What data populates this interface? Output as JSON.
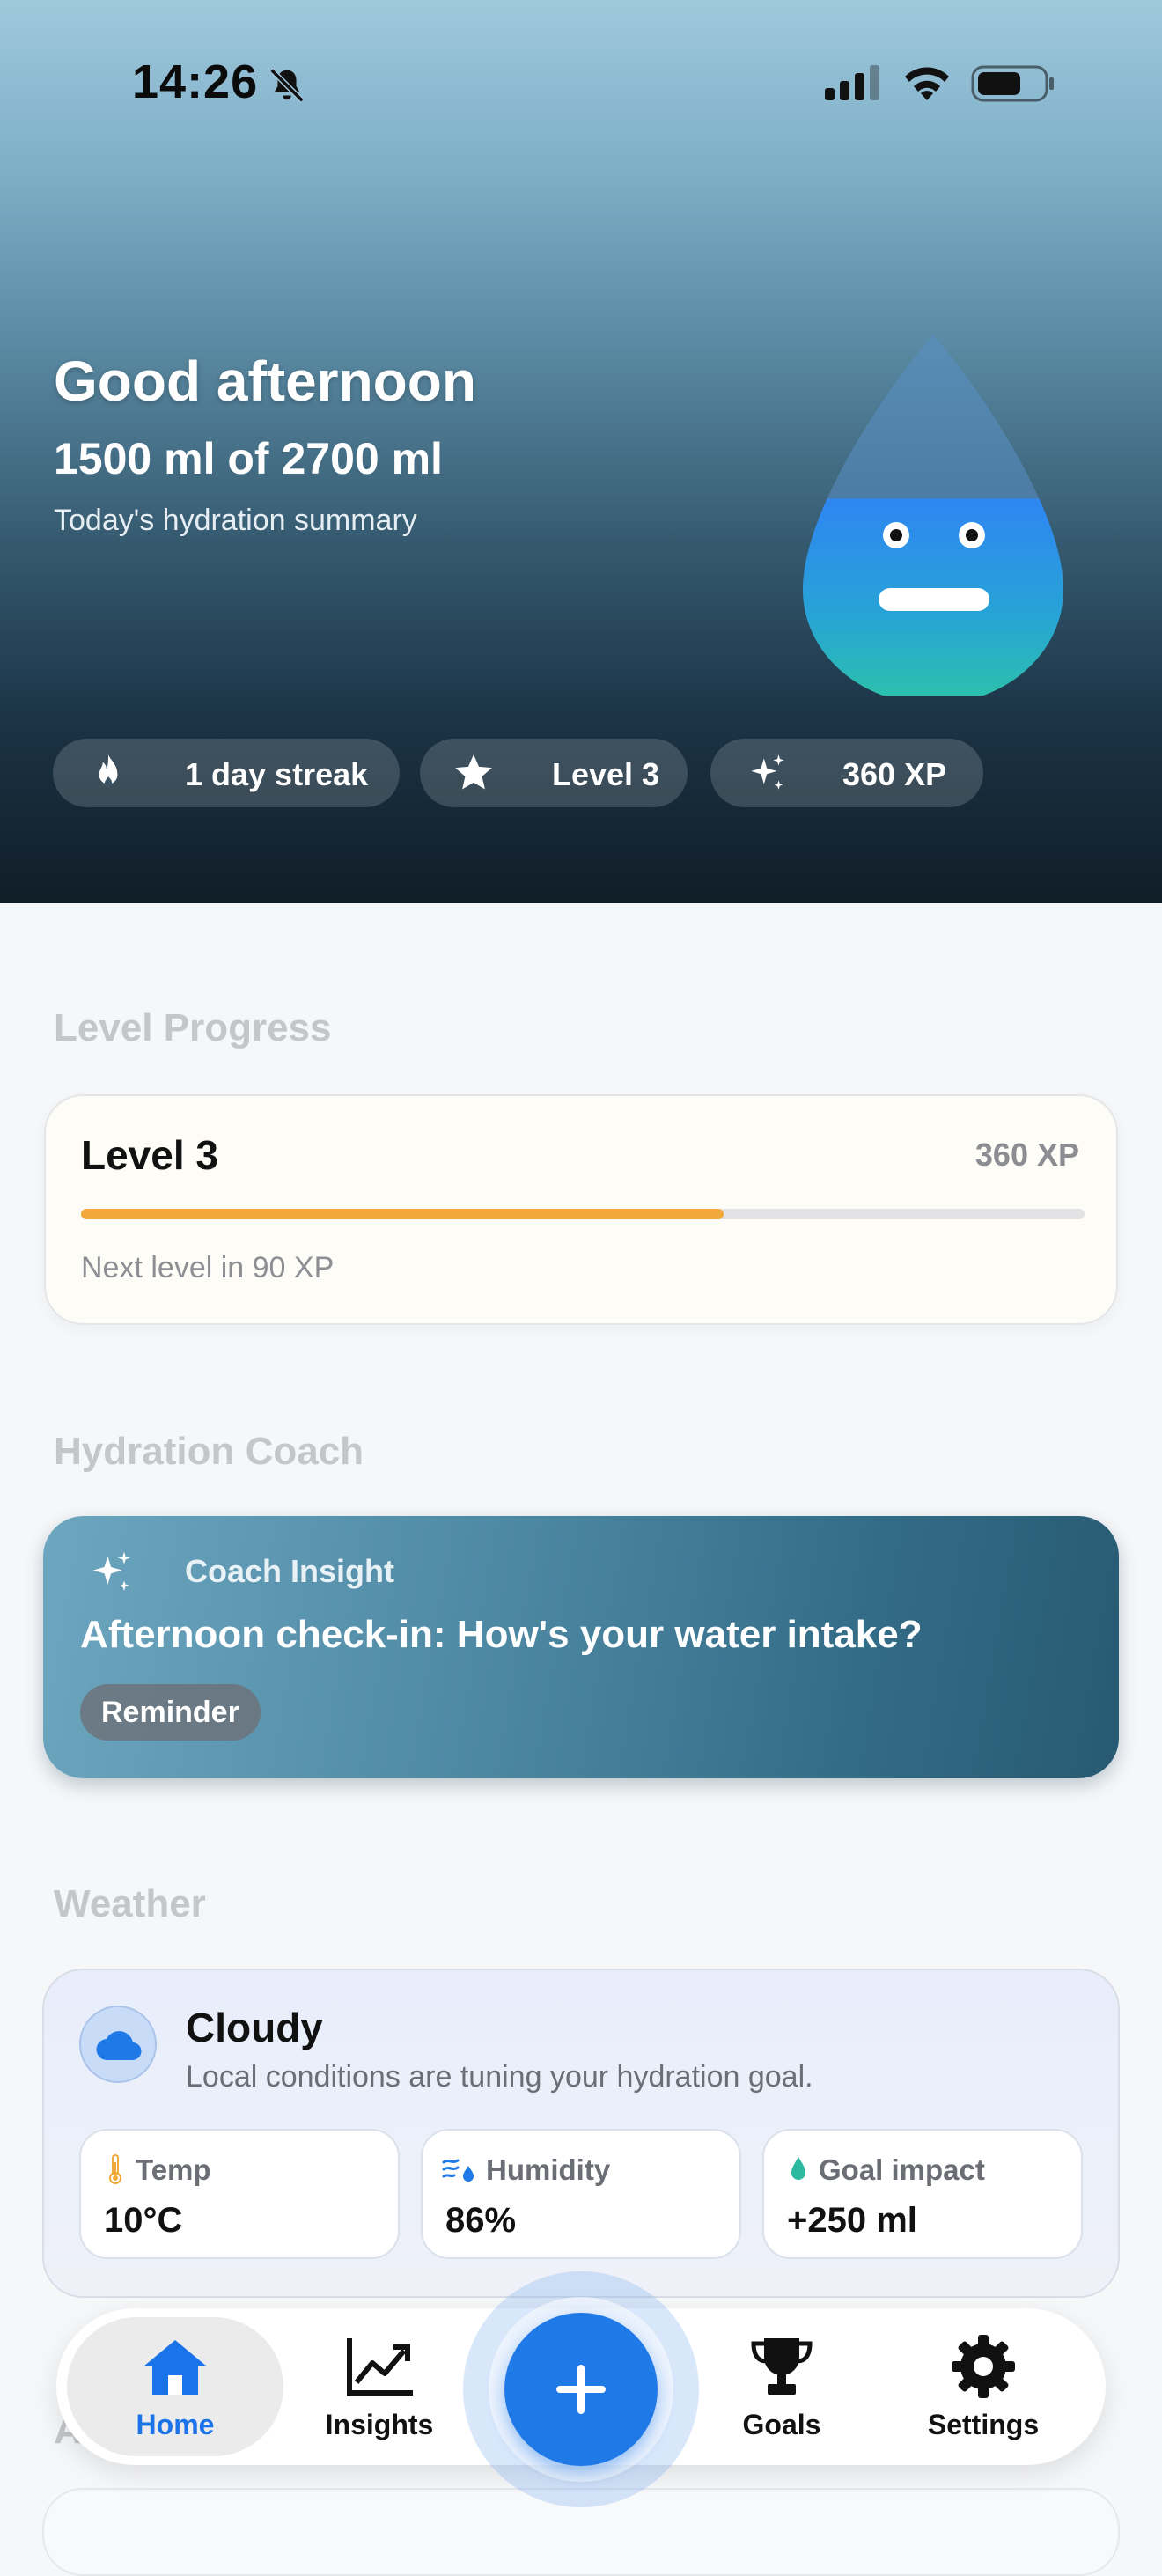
{
  "status_bar": {
    "time": "14:26"
  },
  "hero": {
    "greeting": "Good afternoon",
    "amount": "1500 ml of 2700 ml",
    "subtitle": "Today's hydration summary",
    "progress_fraction": 0.556,
    "chips": [
      {
        "icon": "flame-icon",
        "label": "1 day streak"
      },
      {
        "icon": "star-icon",
        "label": "Level 3"
      },
      {
        "icon": "sparkles-icon",
        "label": "360 XP"
      }
    ]
  },
  "level_section": {
    "title": "Level Progress",
    "card": {
      "level": "Level 3",
      "xp": "360 XP",
      "progress_fraction": 0.64,
      "next": "Next level in 90 XP",
      "accent": "#f2a93b"
    }
  },
  "coach_section": {
    "title": "Hydration Coach",
    "card": {
      "kicker": "Coach Insight",
      "message": "Afternoon check-in: How's your water intake?",
      "badge": "Reminder"
    }
  },
  "weather_section": {
    "title": "Weather",
    "card": {
      "condition": "Cloudy",
      "description": "Local conditions are tuning your hydration goal.",
      "tiles": [
        {
          "icon": "thermometer-icon",
          "label": "Temp",
          "value": "10°C"
        },
        {
          "icon": "wind-drop-icon",
          "label": "Humidity",
          "value": "86%"
        },
        {
          "icon": "droplet-icon",
          "label": "Goal impact",
          "value": "+250 ml"
        }
      ]
    }
  },
  "partial_section_letter": "A",
  "tab_bar": {
    "tabs": [
      {
        "icon": "home-icon",
        "label": "Home",
        "active": true
      },
      {
        "icon": "chart-icon",
        "label": "Insights",
        "active": false
      },
      {
        "icon": "trophy-icon",
        "label": "Goals",
        "active": false
      },
      {
        "icon": "gear-icon",
        "label": "Settings",
        "active": false
      }
    ],
    "add_button_icon": "plus-icon",
    "accent": "#1a73e8"
  }
}
